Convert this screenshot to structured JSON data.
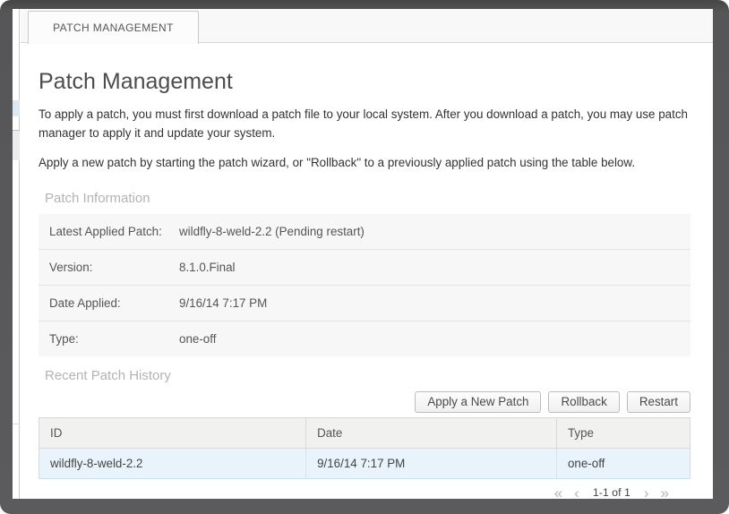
{
  "window": {
    "tab_label": "PATCH MANAGEMENT"
  },
  "page": {
    "title": "Patch Management",
    "intro_1": "To apply a patch, you must first download a patch file to your local system. After you download a patch, you may use patch manager to apply it and update your system.",
    "intro_2": "Apply a new patch by starting the patch wizard, or \"Rollback\" to a previously applied patch using the table below."
  },
  "patch_info": {
    "heading": "Patch Information",
    "rows": [
      {
        "label": "Latest Applied Patch:",
        "value": "wildfly-8-weld-2.2 (Pending restart)"
      },
      {
        "label": "Version:",
        "value": "8.1.0.Final"
      },
      {
        "label": "Date Applied:",
        "value": "9/16/14 7:17 PM"
      },
      {
        "label": "Type:",
        "value": "one-off"
      }
    ]
  },
  "history": {
    "heading": "Recent Patch History",
    "buttons": {
      "apply": "Apply a New Patch",
      "rollback": "Rollback",
      "restart": "Restart"
    },
    "table": {
      "columns": [
        "ID",
        "Date",
        "Type"
      ],
      "rows": [
        [
          "wildfly-8-weld-2.2",
          "9/16/14 7:17 PM",
          "one-off"
        ]
      ]
    },
    "pagination": {
      "first_icon": "«",
      "prev_icon": "‹",
      "label": "1-1 of 1",
      "next_icon": "›",
      "last_icon": "»"
    }
  },
  "colors": {
    "frame": "#58585a",
    "selected_row": "#e9f3fb",
    "section_heading": "#b3b3b3",
    "sliver_highlight": "#dce9f2"
  }
}
